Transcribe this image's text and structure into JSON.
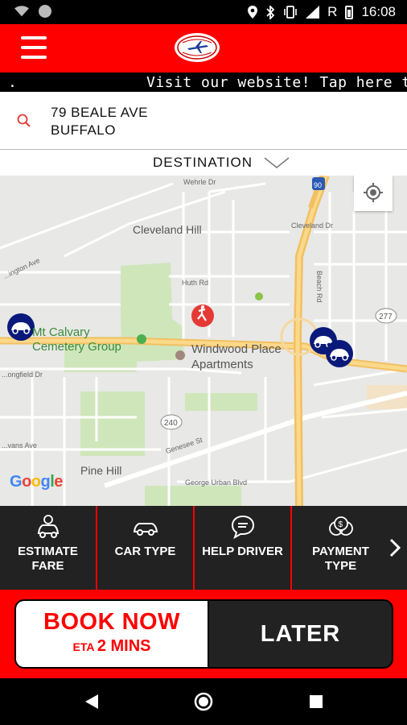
{
  "status_bar": {
    "time": "16:08",
    "network_indicator": "R"
  },
  "ticker": {
    "lead": ".",
    "text": "Visit our website! Tap here to"
  },
  "pickup": {
    "line1": "79 BEALE AVE",
    "line2": "BUFFALO"
  },
  "destination": {
    "label": "DESTINATION"
  },
  "map": {
    "labels": {
      "wehrle": "Wehrle Dr",
      "cleveland_hill": "Cleveland Hill",
      "cleveland_dr": "Cleveland Dr",
      "beach_rd": "Beach Rd",
      "huth_rd": "Huth Rd",
      "abbington": "...ington Ave",
      "mt_calvary": "Mt Calvary\nCemetery Group",
      "windwood": "Windwood Place\nApartments",
      "genesee": "Genesee St",
      "pine_hill": "Pine Hill",
      "george_urban": "George Urban Blvd",
      "songfield": "...ongfield Dr",
      "evans_ave": "...vans Ave",
      "route_90": "90",
      "route_277": "277",
      "route_240": "240",
      "google": "Google"
    }
  },
  "toolbar": {
    "items": [
      {
        "label": "ESTIMATE\nFARE"
      },
      {
        "label": "CAR TYPE"
      },
      {
        "label": "HELP DRIVER"
      },
      {
        "label": "PAYMENT\nTYPE"
      }
    ]
  },
  "booking": {
    "book_now": "BOOK NOW",
    "eta_prefix": "ETA",
    "eta_value": "2 MINS",
    "later": "LATER"
  },
  "colors": {
    "brand_red": "#ff0000",
    "dark": "#222222",
    "car_blue": "#0a1a7a"
  }
}
